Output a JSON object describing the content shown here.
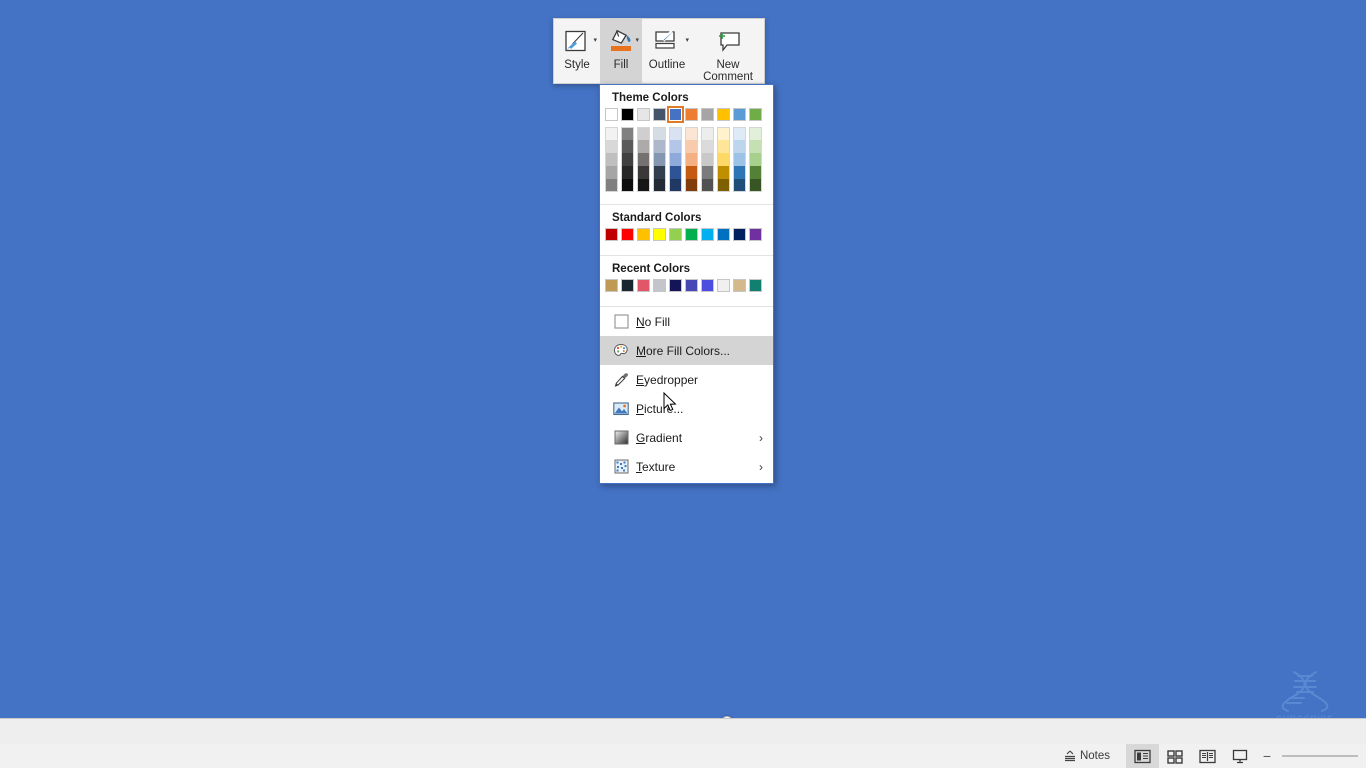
{
  "app": {
    "background_color": "#4472c4",
    "accent_orange": "#e07a26"
  },
  "mini_toolbar": {
    "items": [
      {
        "label": "Style",
        "icon": "style-brush-icon",
        "has_caret": true,
        "selected": false
      },
      {
        "label": "Fill",
        "icon": "fill-bucket-icon",
        "has_caret": true,
        "selected": true
      },
      {
        "label": "Outline",
        "icon": "outline-pen-icon",
        "has_caret": true,
        "selected": false
      },
      {
        "label": "New",
        "label2": "Comment",
        "icon": "new-comment-icon",
        "has_caret": false,
        "selected": false
      }
    ]
  },
  "fill_menu": {
    "theme_colors_title": "Theme Colors",
    "theme_colors": [
      {
        "name": "white",
        "hex": "#ffffff",
        "selected": false
      },
      {
        "name": "black",
        "hex": "#000000",
        "selected": false
      },
      {
        "name": "light-gray",
        "hex": "#e7e6e6",
        "selected": false
      },
      {
        "name": "dark-blue",
        "hex": "#44546a",
        "selected": false
      },
      {
        "name": "blue-accent1",
        "hex": "#4472c4",
        "selected": true
      },
      {
        "name": "orange",
        "hex": "#ed7d31",
        "selected": false
      },
      {
        "name": "gray",
        "hex": "#a5a5a5",
        "selected": false
      },
      {
        "name": "gold",
        "hex": "#ffc000",
        "selected": false
      },
      {
        "name": "light-blue",
        "hex": "#5b9bd5",
        "selected": false
      },
      {
        "name": "green",
        "hex": "#70ad47",
        "selected": false
      }
    ],
    "theme_tints": [
      [
        "#f2f2f2",
        "#d8d8d8",
        "#bfbfbf",
        "#a6a6a6",
        "#808080"
      ],
      [
        "#808080",
        "#595959",
        "#404040",
        "#262626",
        "#0d0d0d"
      ],
      [
        "#d0cece",
        "#aeaaaa",
        "#767171",
        "#3b3838",
        "#161616"
      ],
      [
        "#d6dce4",
        "#adb9ca",
        "#8496b0",
        "#323f4f",
        "#222a35"
      ],
      [
        "#d9e2f3",
        "#b4c6e7",
        "#8eaadb",
        "#2f5496",
        "#1f3864"
      ],
      [
        "#fbe5d5",
        "#f7cbac",
        "#f4b083",
        "#c55a11",
        "#833c0b"
      ],
      [
        "#ededed",
        "#dbdbdb",
        "#c9c9c9",
        "#7b7b7b",
        "#525252"
      ],
      [
        "#fff2cc",
        "#ffe598",
        "#ffd965",
        "#bf8f00",
        "#7f6000"
      ],
      [
        "#deebf6",
        "#bdd6ee",
        "#9cc3e5",
        "#2e75b5",
        "#1f4e79"
      ],
      [
        "#e2efd9",
        "#c5e0b3",
        "#a8d08d",
        "#538135",
        "#375623"
      ]
    ],
    "standard_colors_title": "Standard Colors",
    "standard_colors": [
      {
        "name": "dark-red",
        "hex": "#c00000"
      },
      {
        "name": "red",
        "hex": "#ff0000"
      },
      {
        "name": "orange",
        "hex": "#ffc000"
      },
      {
        "name": "yellow",
        "hex": "#ffff00"
      },
      {
        "name": "light-green",
        "hex": "#92d050"
      },
      {
        "name": "green",
        "hex": "#00b050"
      },
      {
        "name": "light-blue",
        "hex": "#00b0f0"
      },
      {
        "name": "blue",
        "hex": "#0070c0"
      },
      {
        "name": "dark-blue",
        "hex": "#002060"
      },
      {
        "name": "purple",
        "hex": "#7030a0"
      }
    ],
    "recent_colors_title": "Recent Colors",
    "recent_colors": [
      {
        "name": "recent-1",
        "hex": "#bf9a56"
      },
      {
        "name": "recent-2",
        "hex": "#17262f"
      },
      {
        "name": "recent-3",
        "hex": "#e15668"
      },
      {
        "name": "recent-4",
        "hex": "#c3c5ca"
      },
      {
        "name": "recent-5",
        "hex": "#141458"
      },
      {
        "name": "recent-6",
        "hex": "#4646b4"
      },
      {
        "name": "recent-7",
        "hex": "#4d4de0"
      },
      {
        "name": "recent-8",
        "hex": "#f0f0f0"
      },
      {
        "name": "recent-9",
        "hex": "#d4b98c"
      },
      {
        "name": "recent-10",
        "hex": "#128071"
      }
    ],
    "items": [
      {
        "label": "No Fill",
        "accel": "N",
        "icon": "empty-square-icon",
        "submenu": false,
        "hover": false
      },
      {
        "label": "More Fill Colors...",
        "accel": "M",
        "icon": "palette-icon",
        "submenu": false,
        "hover": true
      },
      {
        "label": "Eyedropper",
        "accel": "E",
        "icon": "eyedropper-icon",
        "submenu": false,
        "hover": false
      },
      {
        "label": "Picture...",
        "accel": "P",
        "icon": "picture-icon",
        "submenu": false,
        "hover": false
      },
      {
        "label": "Gradient",
        "accel": "G",
        "icon": "gradient-icon",
        "submenu": true,
        "hover": false
      },
      {
        "label": "Texture",
        "accel": "T",
        "icon": "texture-icon",
        "submenu": true,
        "hover": false
      }
    ],
    "submenu_arrow": "›"
  },
  "watermark": {
    "text": "SUBSCRIBE",
    "icon": "dna-helix-icon"
  },
  "status_bar": {
    "notes_label": "Notes",
    "notes_icon": "notes-icon",
    "views": [
      {
        "name": "normal-view",
        "icon": "normal-view-icon",
        "active": true
      },
      {
        "name": "slide-sorter-view",
        "icon": "slide-sorter-icon",
        "active": false
      },
      {
        "name": "reading-view",
        "icon": "reading-view-icon",
        "active": false
      },
      {
        "name": "slideshow-view",
        "icon": "slideshow-icon",
        "active": false
      }
    ],
    "zoom_out_label": "−"
  }
}
